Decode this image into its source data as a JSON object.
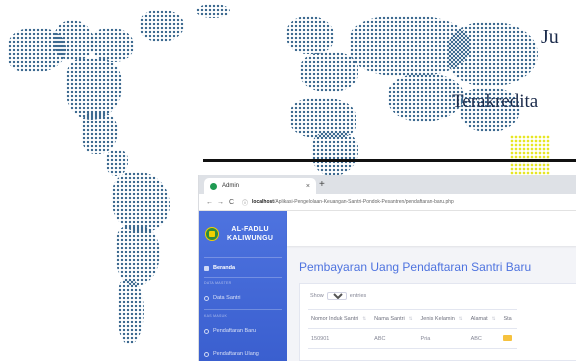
{
  "slide": {
    "title": "Ju",
    "subtitle": "Terakredita"
  },
  "browser": {
    "tab": {
      "title": "Admin",
      "close": "×",
      "new_tab": "+"
    },
    "address": {
      "back": "←",
      "forward": "→",
      "reload": "C",
      "info": "ⓘ",
      "host": "localhost",
      "path": "/Aplikasi-Pengelolaan-Keuangan-Santri-Pondok-Pesantren/pendaftaran-baru.php"
    }
  },
  "sidebar": {
    "brand_line1": "AL-FADLU",
    "brand_line2": "KALIWUNGU",
    "items": [
      {
        "label": "Beranda"
      },
      {
        "label": "Data Santri"
      },
      {
        "label": "Pendaftaran Baru"
      },
      {
        "label": "Pendaftaran Ulang"
      }
    ],
    "headings": [
      "DATA MASTER",
      "KAS MASUK"
    ]
  },
  "main": {
    "heading": "Pembayaran Uang Pendaftaran Santri Baru",
    "length_menu": {
      "show": "Show",
      "selected": "10",
      "entries": "entries"
    },
    "table": {
      "columns": [
        "Nomor Induk Santri",
        "Nama Santri",
        "Jenis Kelamin",
        "Alamat",
        "Sta"
      ],
      "rows": [
        [
          "150901",
          "ABC",
          "Pria",
          "ABC"
        ]
      ]
    }
  },
  "colors": {
    "sidebar": "#4e73df",
    "heading": "#4e73df",
    "map_dots": "#2c5d86",
    "status_chip": "#f6c23e",
    "logo": "#2e8b3e"
  }
}
